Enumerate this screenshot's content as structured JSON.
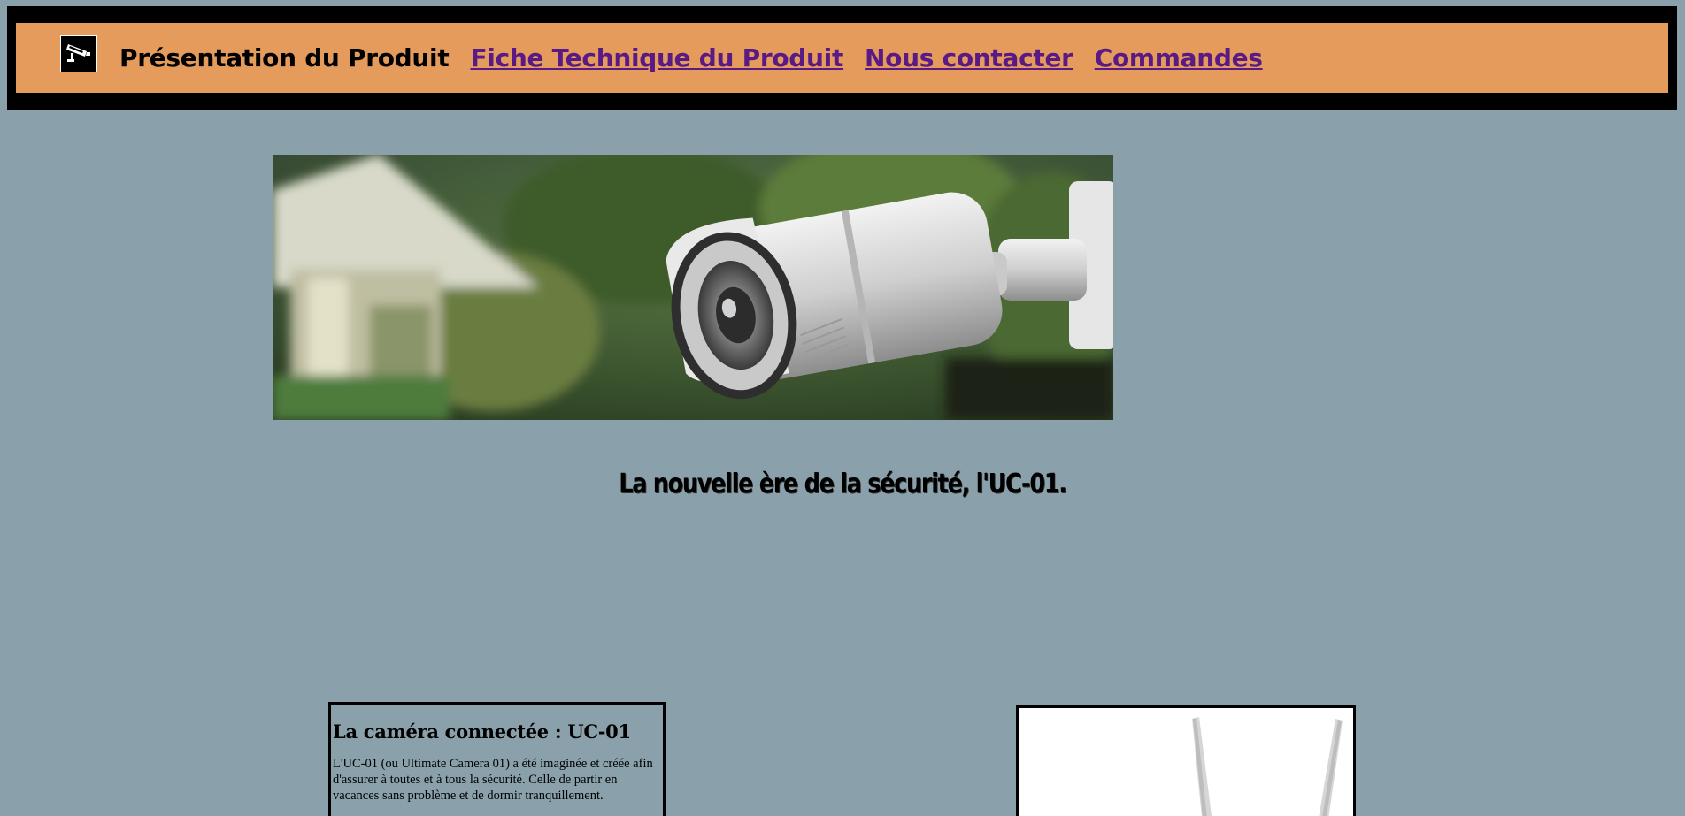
{
  "nav": {
    "current": "Présentation du Produit",
    "links": [
      "Fiche Technique du Produit",
      "Nous contacter",
      "Commandes"
    ]
  },
  "logo": {
    "icon": "security-camera-icon"
  },
  "hero": {
    "icon": "surveillance-camera-photo"
  },
  "tagline": "La nouvelle ère de la sécurité, l'UC-01.",
  "info": {
    "title": "La caméra connectée : UC-01",
    "body": "L'UC-01 (ou Ultimate Camera 01) a été imaginée et créée afin d'assurer à toutes et à tous la sécurité. Celle de partir en vacances sans problème et de dormir tranquillement."
  },
  "product": {
    "icon": "camera-antenna-photo"
  },
  "colors": {
    "background": "#8aa1ac",
    "header_bar": "#e49b5b",
    "link": "#5a1a85"
  }
}
